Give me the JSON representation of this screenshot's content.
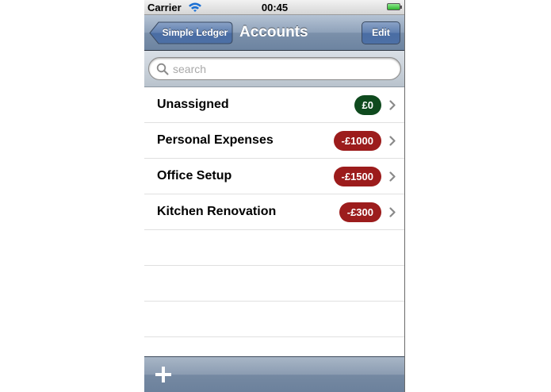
{
  "status_bar": {
    "carrier": "Carrier",
    "time": "00:45",
    "wifi_icon": "wifi-icon",
    "battery_icon": "battery-icon"
  },
  "nav_bar": {
    "back_label": "Simple Ledger",
    "title": "Accounts",
    "edit_label": "Edit"
  },
  "search": {
    "placeholder": "search",
    "value": ""
  },
  "accounts": [
    {
      "name": "Unassigned",
      "balance": "£0",
      "status": "positive"
    },
    {
      "name": "Personal Expenses",
      "balance": "-£1000",
      "status": "negative"
    },
    {
      "name": "Office Setup",
      "balance": "-£1500",
      "status": "negative"
    },
    {
      "name": "Kitchen Renovation",
      "balance": "-£300",
      "status": "negative"
    }
  ],
  "toolbar": {
    "add_icon": "plus-icon"
  },
  "colors": {
    "positive_badge": "#0f4a1e",
    "negative_badge": "#9c1c1c",
    "nav_bar": "#7b90aa"
  }
}
